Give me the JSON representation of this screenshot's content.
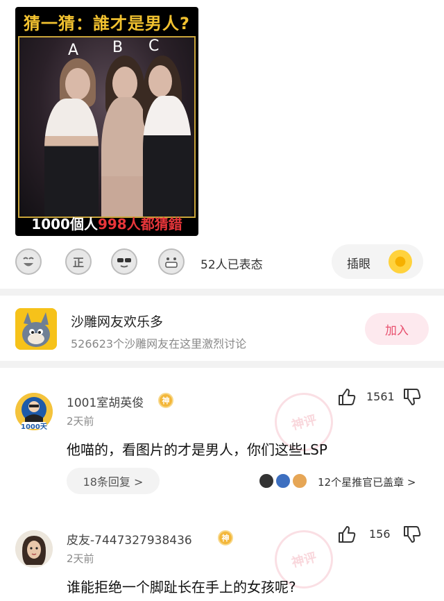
{
  "meme": {
    "title": "猜一猜：誰才是男人?",
    "letters": [
      "A",
      "B",
      "C"
    ],
    "caption_prefix": "1000個人",
    "caption_highlight": "998人都猜錯"
  },
  "reactions": {
    "emojis": [
      "laugh-emoji",
      "zheng-emoji",
      "sunglasses-emoji",
      "grin-emoji"
    ],
    "zheng_label": "正",
    "count_text": "52人已表态",
    "chayan_label": "插眼"
  },
  "group": {
    "name": "沙雕网友欢乐多",
    "description": "526623个沙雕网友在这里激烈讨论",
    "join_label": "加入"
  },
  "comments": [
    {
      "username": "1001室胡英俊",
      "badge": "神",
      "avatar_label": "1000天",
      "time": "2天前",
      "text": "他喵的，看图片的才是男人，你们这些LSP",
      "likes": "1561",
      "replies_label": "18条回复 >",
      "stamp_text": "12个星推官已盖章 >",
      "watermark": "神评"
    },
    {
      "username": "皮友-7447327938436",
      "badge": "神",
      "time": "2天前",
      "text": "谁能拒绝一个脚趾长在手上的女孩呢?",
      "likes": "156",
      "watermark": "神评"
    }
  ],
  "colors": {
    "accent_pink": "#e8506e",
    "badge_gold": "#f3b73a",
    "meme_title_yellow": "#f2c230",
    "meme_caption_red": "#e8363a"
  }
}
